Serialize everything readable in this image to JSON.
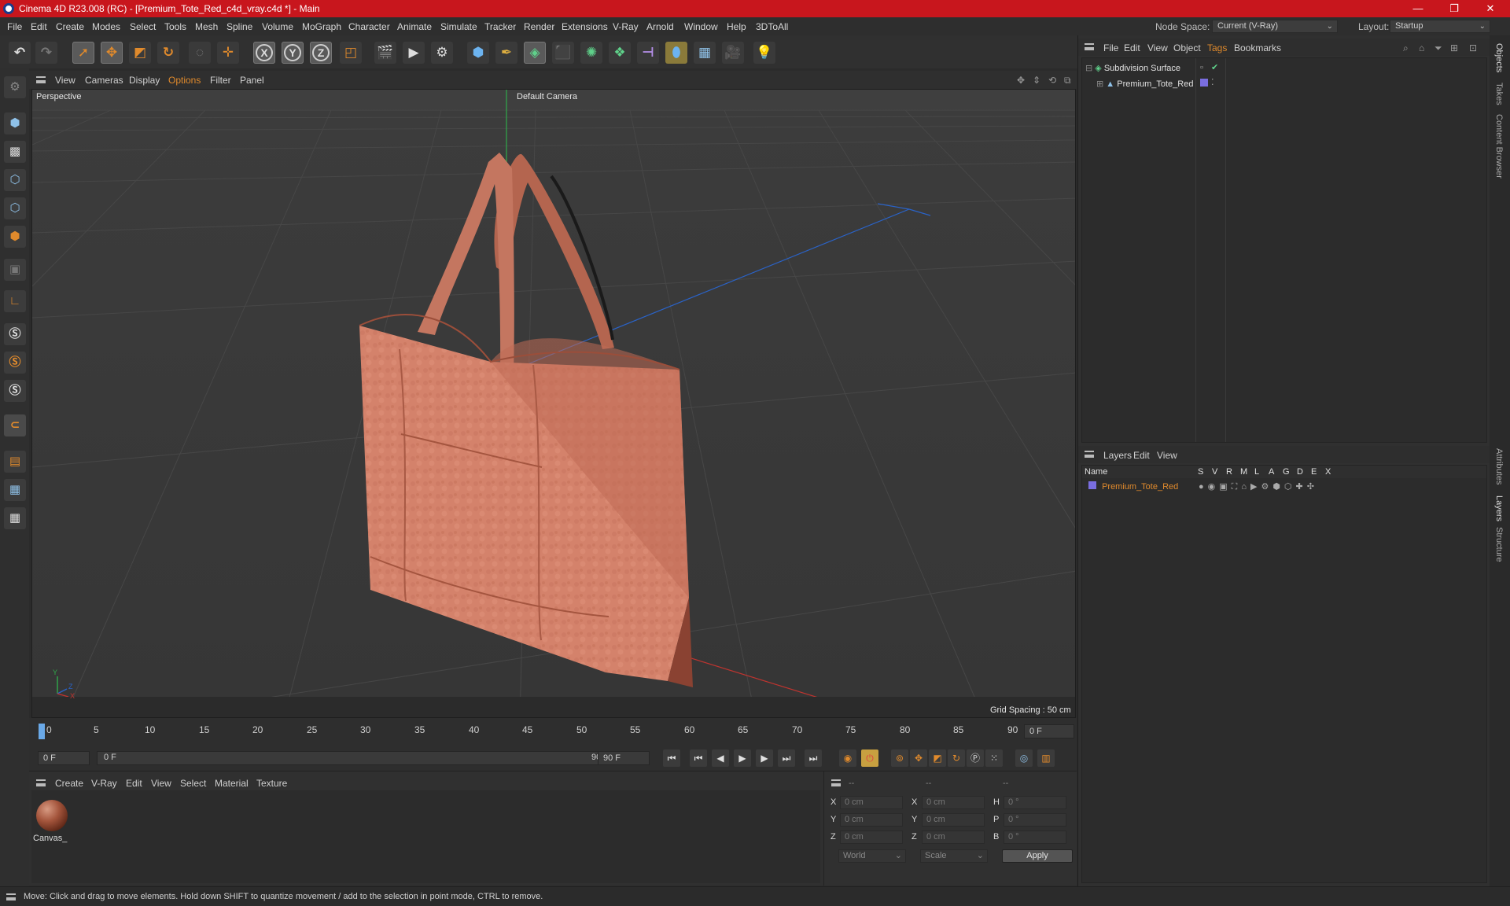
{
  "window": {
    "title": "Cinema 4D R23.008 (RC) - [Premium_Tote_Red_c4d_vray.c4d *] - Main",
    "controls": [
      "—",
      "❐",
      "✕"
    ]
  },
  "menubar": {
    "items": [
      "File",
      "Edit",
      "Create",
      "Modes",
      "Select",
      "Tools",
      "Mesh",
      "Spline",
      "Volume",
      "MoGraph",
      "Character",
      "Animate",
      "Simulate",
      "Tracker",
      "Render",
      "Extensions",
      "V-Ray",
      "Arnold",
      "Window",
      "Help",
      "3DToAll"
    ],
    "node_space_label": "Node Space:",
    "node_space_value": "Current (V-Ray)",
    "layout_label": "Layout:",
    "layout_value": "Startup"
  },
  "viewport": {
    "menu": [
      "View",
      "Cameras",
      "Display",
      "Options",
      "Filter",
      "Panel"
    ],
    "active_menu": "Options",
    "label": "Perspective",
    "camera": "Default Camera",
    "grid_spacing": "Grid Spacing : 50 cm",
    "axis_labels": {
      "y": "Y",
      "z": "Z",
      "x": "X"
    }
  },
  "timeline": {
    "ticks": [
      "0",
      "5",
      "10",
      "15",
      "20",
      "25",
      "30",
      "35",
      "40",
      "45",
      "50",
      "55",
      "60",
      "65",
      "70",
      "75",
      "80",
      "85",
      "90"
    ],
    "current_frame": "0 F",
    "start_field": "0 F",
    "range_start": "0 F",
    "range_end": "90 F",
    "end_field": "90 F"
  },
  "material_manager": {
    "menu": [
      "Create",
      "V-Ray",
      "Edit",
      "View",
      "Select",
      "Material",
      "Texture"
    ],
    "materials": [
      {
        "name": "Canvas_"
      }
    ]
  },
  "coordinates": {
    "headers": [
      "--",
      "--",
      "--"
    ],
    "rows": [
      {
        "a": "X",
        "av": "0 cm",
        "b": "X",
        "bv": "0 cm",
        "c": "H",
        "cv": "0 °"
      },
      {
        "a": "Y",
        "av": "0 cm",
        "b": "Y",
        "bv": "0 cm",
        "c": "P",
        "cv": "0 °"
      },
      {
        "a": "Z",
        "av": "0 cm",
        "b": "Z",
        "bv": "0 cm",
        "c": "B",
        "cv": "0 °"
      }
    ],
    "space": "World",
    "mode": "Scale",
    "apply": "Apply"
  },
  "objects_panel": {
    "menu": [
      "File",
      "Edit",
      "View",
      "Object",
      "Tags",
      "Bookmarks"
    ],
    "active_menu": "Tags",
    "tree": [
      {
        "name": "Subdivision Surface",
        "level": 0
      },
      {
        "name": "Premium_Tote_Red",
        "level": 1
      }
    ]
  },
  "layers_panel": {
    "menu": [
      "Layers",
      "Edit",
      "View"
    ],
    "columns": [
      "Name",
      "S",
      "V",
      "R",
      "M",
      "L",
      "A",
      "G",
      "D",
      "E",
      "X"
    ],
    "layers": [
      {
        "name": "Premium_Tote_Red",
        "color": "#7a6ee0"
      }
    ]
  },
  "side_tabs": [
    "Objects",
    "Takes",
    "Content Browser",
    "Attributes",
    "Layers",
    "Structure"
  ],
  "status": "Move: Click and drag to move elements. Hold down SHIFT to quantize movement / add to the selection in point mode, CTRL to remove.",
  "colors": {
    "accent": "#e08a2c",
    "titlebar": "#c8161d",
    "bag": "#d4826b"
  }
}
